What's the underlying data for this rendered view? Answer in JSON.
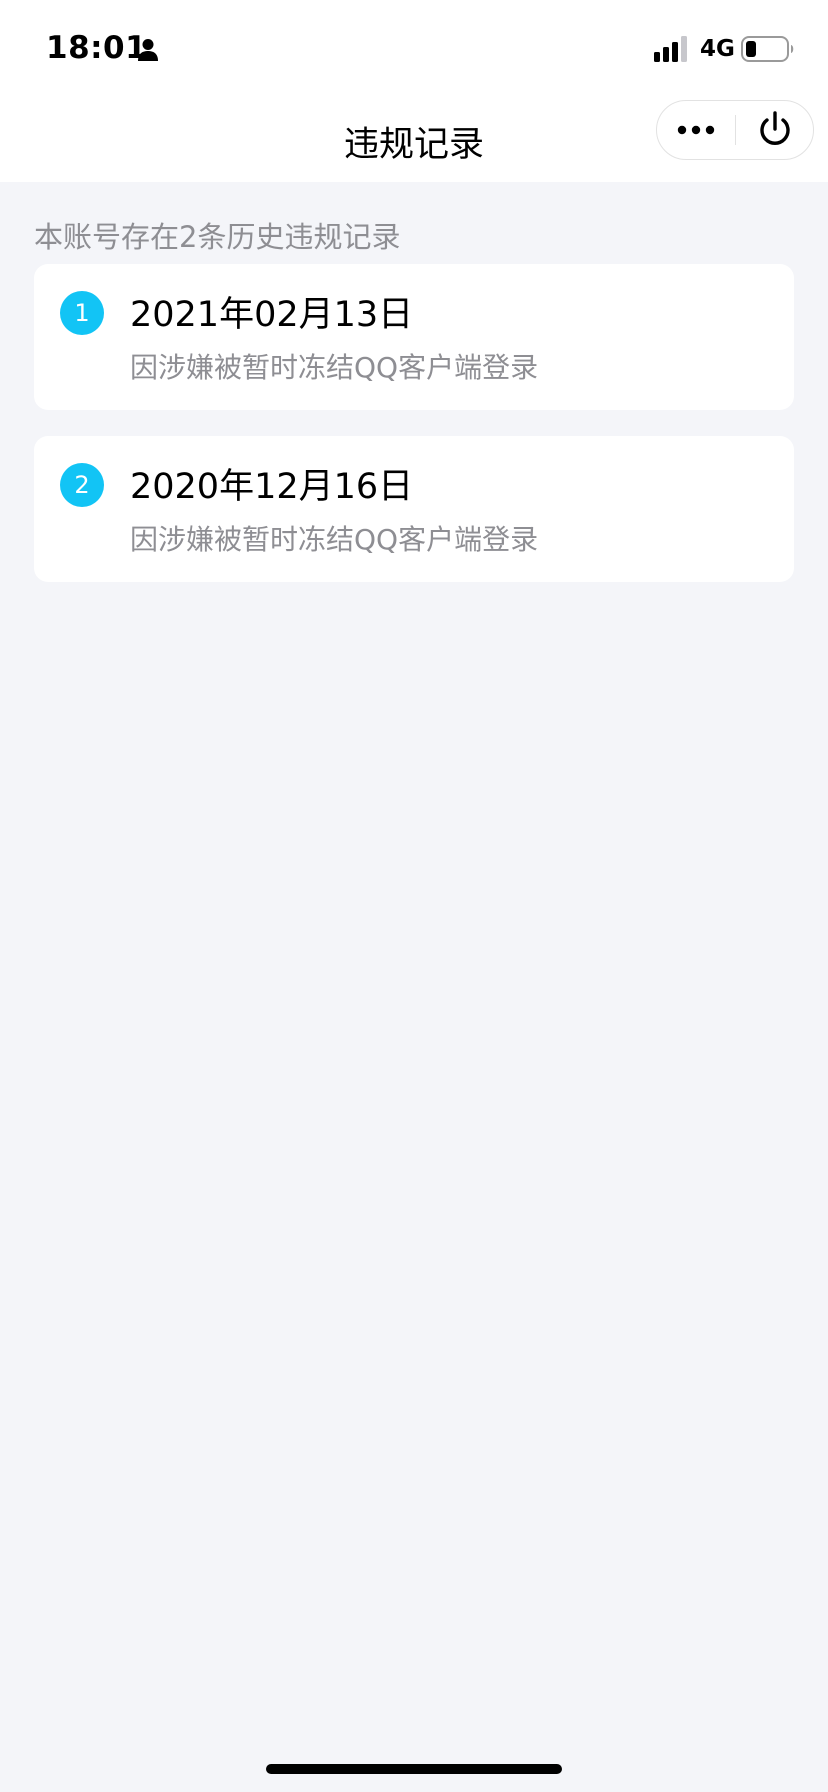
{
  "status_bar": {
    "time": "18:01",
    "network": "4G",
    "icons": [
      "person-icon",
      "signal-icon",
      "battery-icon"
    ]
  },
  "nav": {
    "title": "违规记录",
    "buttons": [
      "more-icon",
      "power-icon"
    ]
  },
  "summary": "本账号存在2条历史违规记录",
  "records": [
    {
      "index": "1",
      "date": "2021年02月13日",
      "reason": "因涉嫌被暂时冻结QQ客户端登录"
    },
    {
      "index": "2",
      "date": "2020年12月16日",
      "reason": "因涉嫌被暂时冻结QQ客户端登录"
    }
  ],
  "colors": {
    "accent": "#12c4f5",
    "background": "#f4f5f9",
    "secondary_text": "#8e8e93"
  }
}
